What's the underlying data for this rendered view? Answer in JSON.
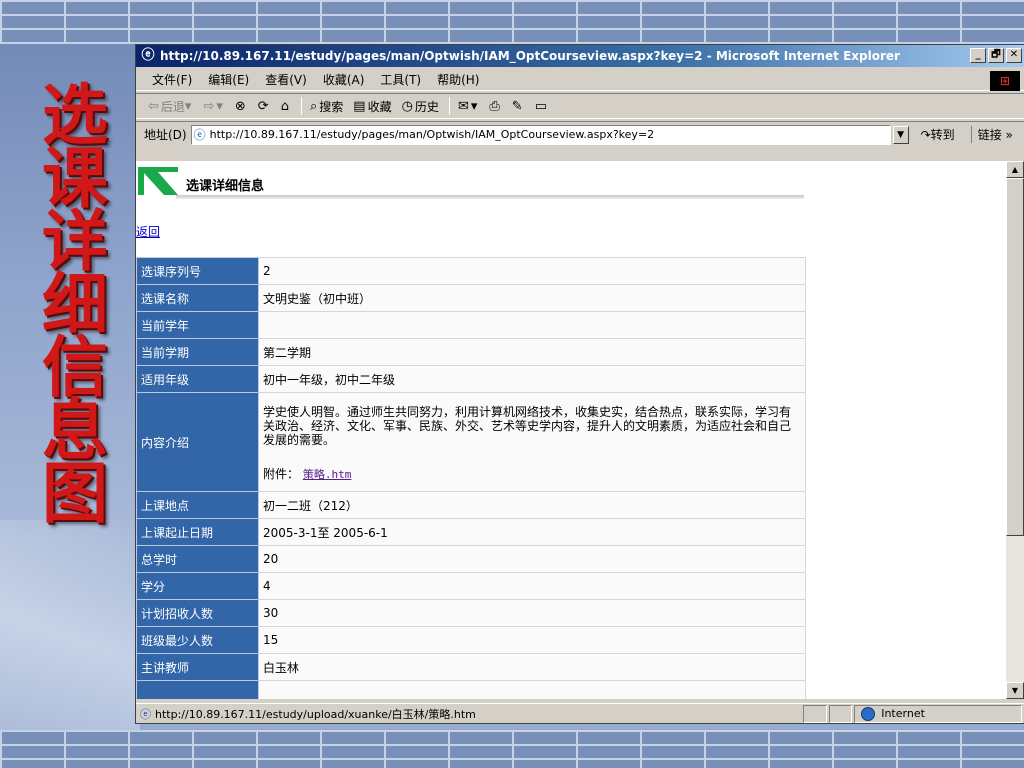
{
  "slide": {
    "big_title_chars": [
      "选",
      "课",
      "详",
      "细",
      "信",
      "息",
      "图"
    ]
  },
  "browser": {
    "title": "http://10.89.167.11/estudy/pages/man/Optwish/IAM_OptCourseview.aspx?key=2 - Microsoft Internet Explorer",
    "window_buttons": {
      "minimize": "_",
      "maximize": "🗗",
      "close": "✕"
    },
    "menu": [
      "文件(F)",
      "编辑(E)",
      "查看(V)",
      "收藏(A)",
      "工具(T)",
      "帮助(H)"
    ],
    "toolbar": {
      "back": "后退",
      "search": "搜索",
      "favorites": "收藏",
      "history": "历史"
    },
    "address_label": "地址(D)",
    "address_value": "http://10.89.167.11/estudy/pages/man/Optwish/IAM_OptCourseview.aspx?key=2",
    "go_label": "转到",
    "links_label": "链接 »",
    "status_text": "http://10.89.167.11/estudy/upload/xuanke/白玉林/策略.htm",
    "zone_label": "Internet"
  },
  "page": {
    "heading": "选课详细信息",
    "back_link": "返回",
    "rows": [
      {
        "label": "选课序列号",
        "value": "2"
      },
      {
        "label": "选课名称",
        "value": "文明史鉴（初中班）"
      },
      {
        "label": "当前学年",
        "value": ""
      },
      {
        "label": "当前学期",
        "value": "第二学期"
      },
      {
        "label": "适用年级",
        "value": "初中一年级，初中二年级"
      },
      {
        "label": "上课地点",
        "value": "初一二班（212）"
      },
      {
        "label": "上课起止日期",
        "value": "2005-3-1至 2005-6-1"
      },
      {
        "label": "总学时",
        "value": "20"
      },
      {
        "label": "学分",
        "value": "4"
      },
      {
        "label": "计划招收人数",
        "value": "30"
      },
      {
        "label": "班级最少人数",
        "value": "15"
      },
      {
        "label": "主讲教师",
        "value": "白玉林"
      },
      {
        "label": "",
        "value": ""
      }
    ],
    "intro": {
      "label": "内容介绍",
      "text": "学史使人明智。通过师生共同努力，利用计算机网络技术，收集史实，结合热点，联系实际，学习有关政治、经济、文化、军事、民族、外交、艺术等史学内容，提升人的文明素质，为适应社会和自己发展的需要。",
      "attachment_label": "附件：",
      "attachment_link": "策略.htm"
    }
  },
  "colors": {
    "label_cell": "#3366a8",
    "title_red": "#d01818",
    "titlebar": "#0a246a"
  }
}
